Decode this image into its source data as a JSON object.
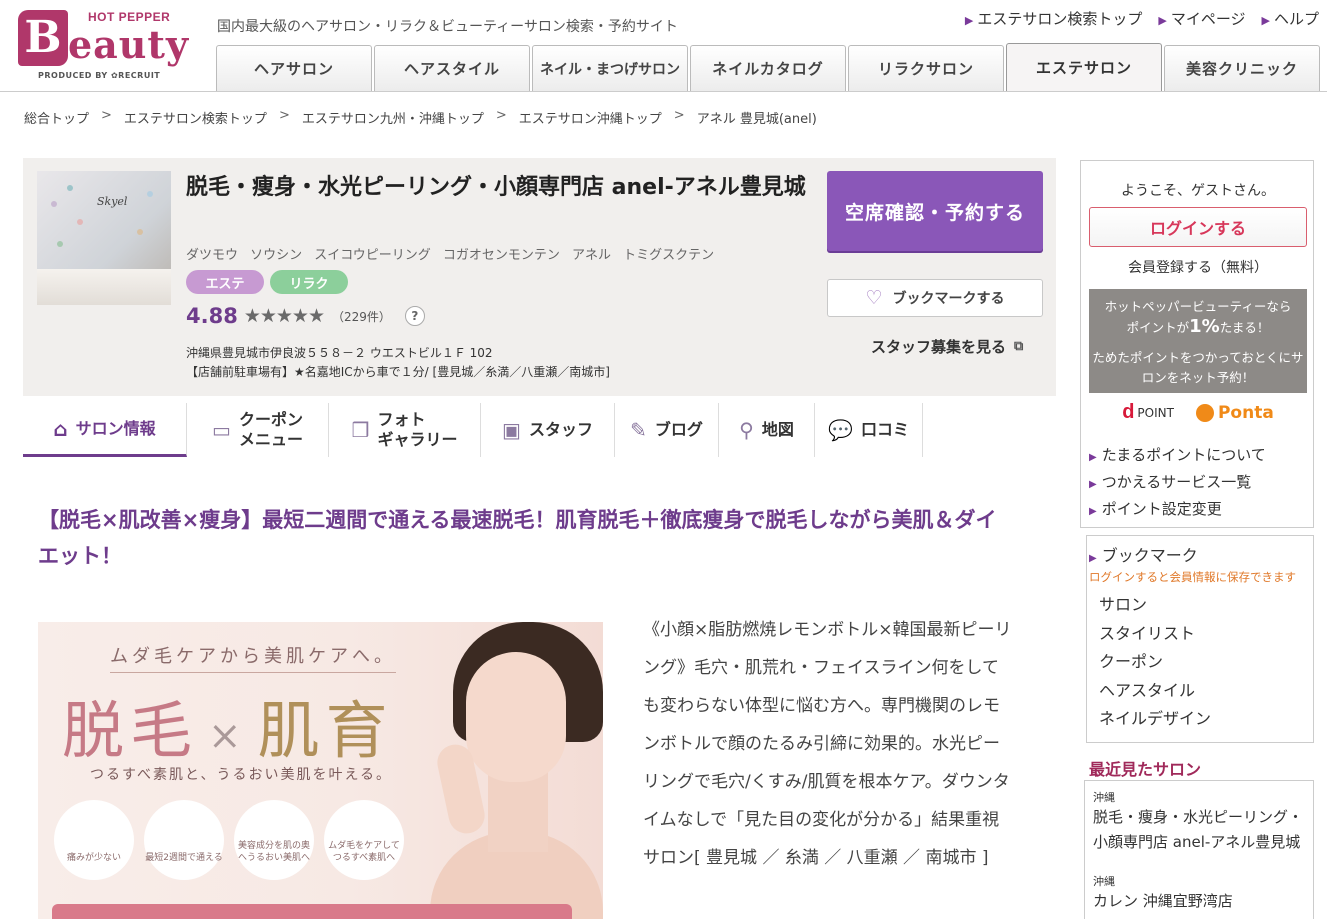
{
  "header": {
    "logo_hotpepper": "HOT PEPPER",
    "logo_b": "B",
    "logo_eauty": "eauty",
    "logo_produced": "PRODUCED BY ✿RECRUIT",
    "tagline": "国内最大級のヘアサロン・リラク＆ビューティーサロン検索・予約サイト",
    "top_links": [
      "エステサロン検索トップ",
      "マイページ",
      "ヘルプ"
    ],
    "tabs": [
      "ヘアサロン",
      "ヘアスタイル",
      "ネイル・まつげサロン",
      "ネイルカタログ",
      "リラクサロン",
      "エステサロン",
      "美容クリニック"
    ],
    "active_tab": "エステサロン"
  },
  "breadcrumb": [
    "総合トップ",
    "エステサロン検索トップ",
    "エステサロン九州・沖縄トップ",
    "エステサロン沖縄トップ",
    "アネル 豊見城(anel)"
  ],
  "salon": {
    "name": "脱毛・痩身・水光ピーリング・小顔専門店 anel-アネル豊見城",
    "kana": "ダツモウ ソウシン スイコウピーリング コガオセンモンテン アネル トミグスクテン",
    "badges": [
      "エステ",
      "リラク"
    ],
    "rating": "4.88",
    "stars": "★★★★★",
    "review_count": "（229件）",
    "help": "?",
    "photo_sign": "Skyel",
    "address": "沖縄県豊見城市伊良波５５８－２ ウエストビル１Ｆ 102",
    "access": "【店舗前駐車場有】★名嘉地ICから車で１分/ [豊見城／糸満／八重瀬／南城市]",
    "reserve_label": "空席確認・予約する",
    "bookmark_label": "ブックマークする",
    "staff_label": "スタッフ募集を見る"
  },
  "salon_nav": [
    {
      "line1": "サロン情報",
      "line2": ""
    },
    {
      "line1": "クーポン",
      "line2": "メニュー"
    },
    {
      "line1": "フォト",
      "line2": "ギャラリー"
    },
    {
      "line1": "スタッフ",
      "line2": ""
    },
    {
      "line1": "ブログ",
      "line2": ""
    },
    {
      "line1": "地図",
      "line2": ""
    },
    {
      "line1": "口コミ",
      "line2": ""
    }
  ],
  "catch_copy": "【脱毛×肌改善×痩身】最短二週間で通える最速脱毛！肌育脱毛＋徹底痩身で脱毛しながら美肌＆ダイエット！",
  "main_image": {
    "tag": "ムダ毛ケアから美肌ケアへ。",
    "big1": "脱毛",
    "x": "×",
    "big2": "肌育",
    "sub": "つるすべ素肌と、うるおい美肌を叶える。",
    "circles": [
      "痛みが少ない",
      "最短2週間で通える",
      "美容成分を肌の奥へうるおい美肌へ",
      "ムダ毛をケアしてつるすべ素肌へ"
    ]
  },
  "description": "《小顔×脂肪燃焼レモンボトル×韓国最新ピーリング》毛穴・肌荒れ・フェイスライン何をしても変わらない体型に悩む方へ。専門機関のレモンボトルで顔のたるみ引締に効果的。水光ピーリングで毛穴/くすみ/肌質を根本ケア。ダウンタイムなしで「見た目の変化が分かる」結果重視サロン[ 豊見城 ／ 糸満 ／ 八重瀬 ／ 南城市 ]",
  "sidebar": {
    "welcome": "ようこそ、ゲストさん。",
    "login_label": "ログインする",
    "register_label": "会員登録する（無料）",
    "point_line1": "ホットペッパービューティーなら",
    "point_line2a": "ポイントが",
    "point_pct": "1%",
    "point_line2b": "たまる！",
    "point_line3": "ためたポイントをつかっておとくにサロンをネット予約！",
    "dpoint": "POINT",
    "dpoint_d": "d",
    "ponta": "Ponta",
    "links": [
      "たまるポイントについて",
      "つかえるサービス一覧",
      "ポイント設定変更"
    ],
    "bookmark_title": "ブックマーク",
    "bookmark_note": "ログインすると会員情報に保存できます",
    "bookmark_items": [
      "サロン",
      "スタイリスト",
      "クーポン",
      "ヘアスタイル",
      "ネイルデザイン"
    ],
    "recent_title": "最近見たサロン",
    "recent": [
      {
        "pref": "沖縄",
        "name": "脱毛・痩身・水光ピーリング・小顔専門店 anel-アネル豊見城"
      },
      {
        "pref": "沖縄",
        "name": "カレン 沖縄宜野湾店"
      }
    ]
  }
}
